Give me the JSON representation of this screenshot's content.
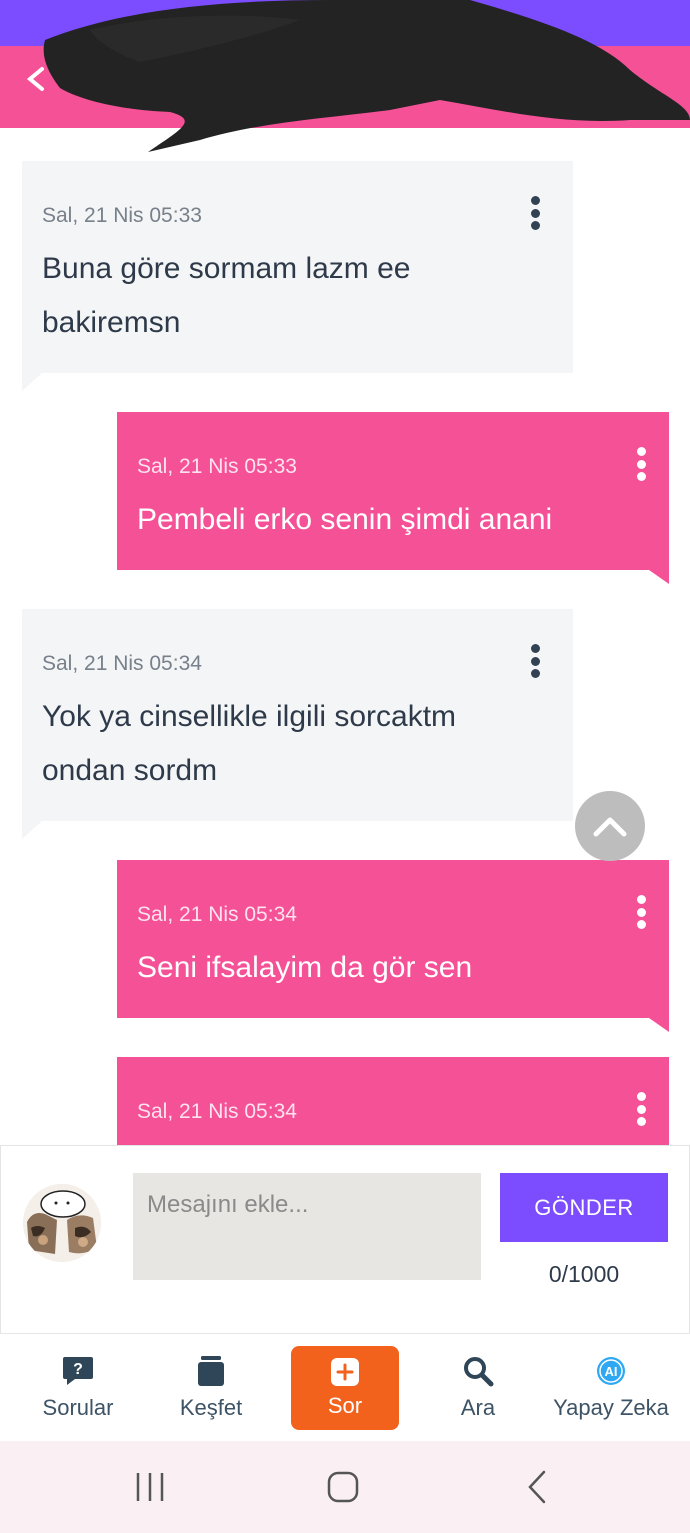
{
  "header": {
    "back_icon": "back-arrow-icon",
    "colors": {
      "status_strip": "#7c4dff",
      "header": "#f55196"
    }
  },
  "messages": [
    {
      "direction": "in",
      "time": "Sal, 21 Nis 05:33",
      "lines": [
        "Buna göre sormam lazm ee",
        "bakiremsn"
      ]
    },
    {
      "direction": "out",
      "time": "Sal, 21 Nis 05:33",
      "lines": [
        "Pembeli erko senin şimdi anani"
      ]
    },
    {
      "direction": "in",
      "time": "Sal, 21 Nis 05:34",
      "lines": [
        "Yok ya cinsellikle ilgili sorcaktm",
        "ondan sordm"
      ]
    },
    {
      "direction": "out",
      "time": "Sal, 21 Nis 05:34",
      "lines": [
        "Seni ifsalayim da gör sen"
      ]
    },
    {
      "direction": "out",
      "time": "Sal, 21 Nis 05:34",
      "lines": []
    }
  ],
  "composer": {
    "placeholder": "Mesajını ekle...",
    "value": "",
    "send_label": "GÖNDER",
    "counter": "0/1000"
  },
  "bottom_nav": {
    "items": [
      {
        "label": "Sorular",
        "icon": "question-bubble-icon"
      },
      {
        "label": "Keşfet",
        "icon": "cards-stack-icon"
      },
      {
        "label": "Sor",
        "icon": "plus-box-icon",
        "active": true
      },
      {
        "label": "Ara",
        "icon": "search-icon"
      },
      {
        "label": "Yapay Zeka",
        "icon": "ai-badge-icon"
      }
    ]
  },
  "system_nav": {
    "icons": [
      "recent-apps-icon",
      "home-icon",
      "back-icon"
    ]
  },
  "colors": {
    "incoming_bubble": "#f4f5f6",
    "outgoing_bubble": "#f55196",
    "send_button": "#7c4dff",
    "ask_button": "#f2621c"
  }
}
